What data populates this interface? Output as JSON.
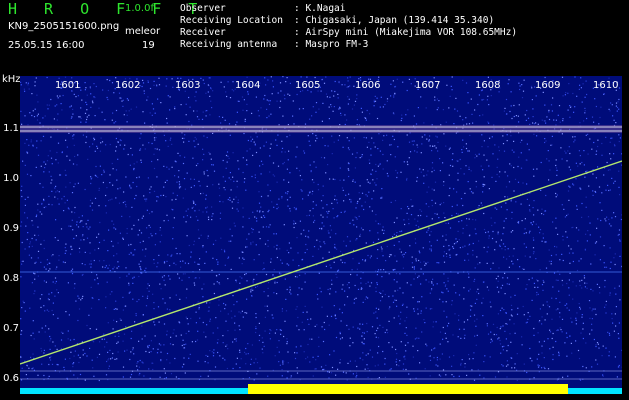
{
  "header": {
    "app_title": "H R O F F T",
    "app_version": "1.0.0f",
    "file_name": "KN9_2505151600.png",
    "mode_label": "meleor",
    "date_time": "25.05.15 16:00",
    "count_value": "19",
    "info": [
      {
        "label": "Observer",
        "value": ": K.Nagai"
      },
      {
        "label": "Receiving Location",
        "value": ": Chigasaki, Japan (139.414 35.340)"
      },
      {
        "label": "Receiver",
        "value": ": AirSpy mini (Miakejima VOR 108.65MHz)"
      },
      {
        "label": "Receiving antenna",
        "value": ": Maspro FM-3"
      }
    ]
  },
  "axes": {
    "y_unit": "kHz",
    "y_ticks": [
      "1.1",
      "1.0",
      "0.9",
      "0.8",
      "0.7",
      "0.6"
    ],
    "x_ticks": [
      "1601",
      "1602",
      "1603",
      "1604",
      "1605",
      "1606",
      "1607",
      "1608",
      "1609",
      "1610"
    ]
  },
  "colors": {
    "background": "#000c7a",
    "noise": "#3a56ff",
    "signal": "#c8ff6a",
    "band": "#ffffff",
    "yellow_bar": "#ffff00",
    "cyan_bar": "#00e5ff",
    "title": "#2ee62e"
  }
}
